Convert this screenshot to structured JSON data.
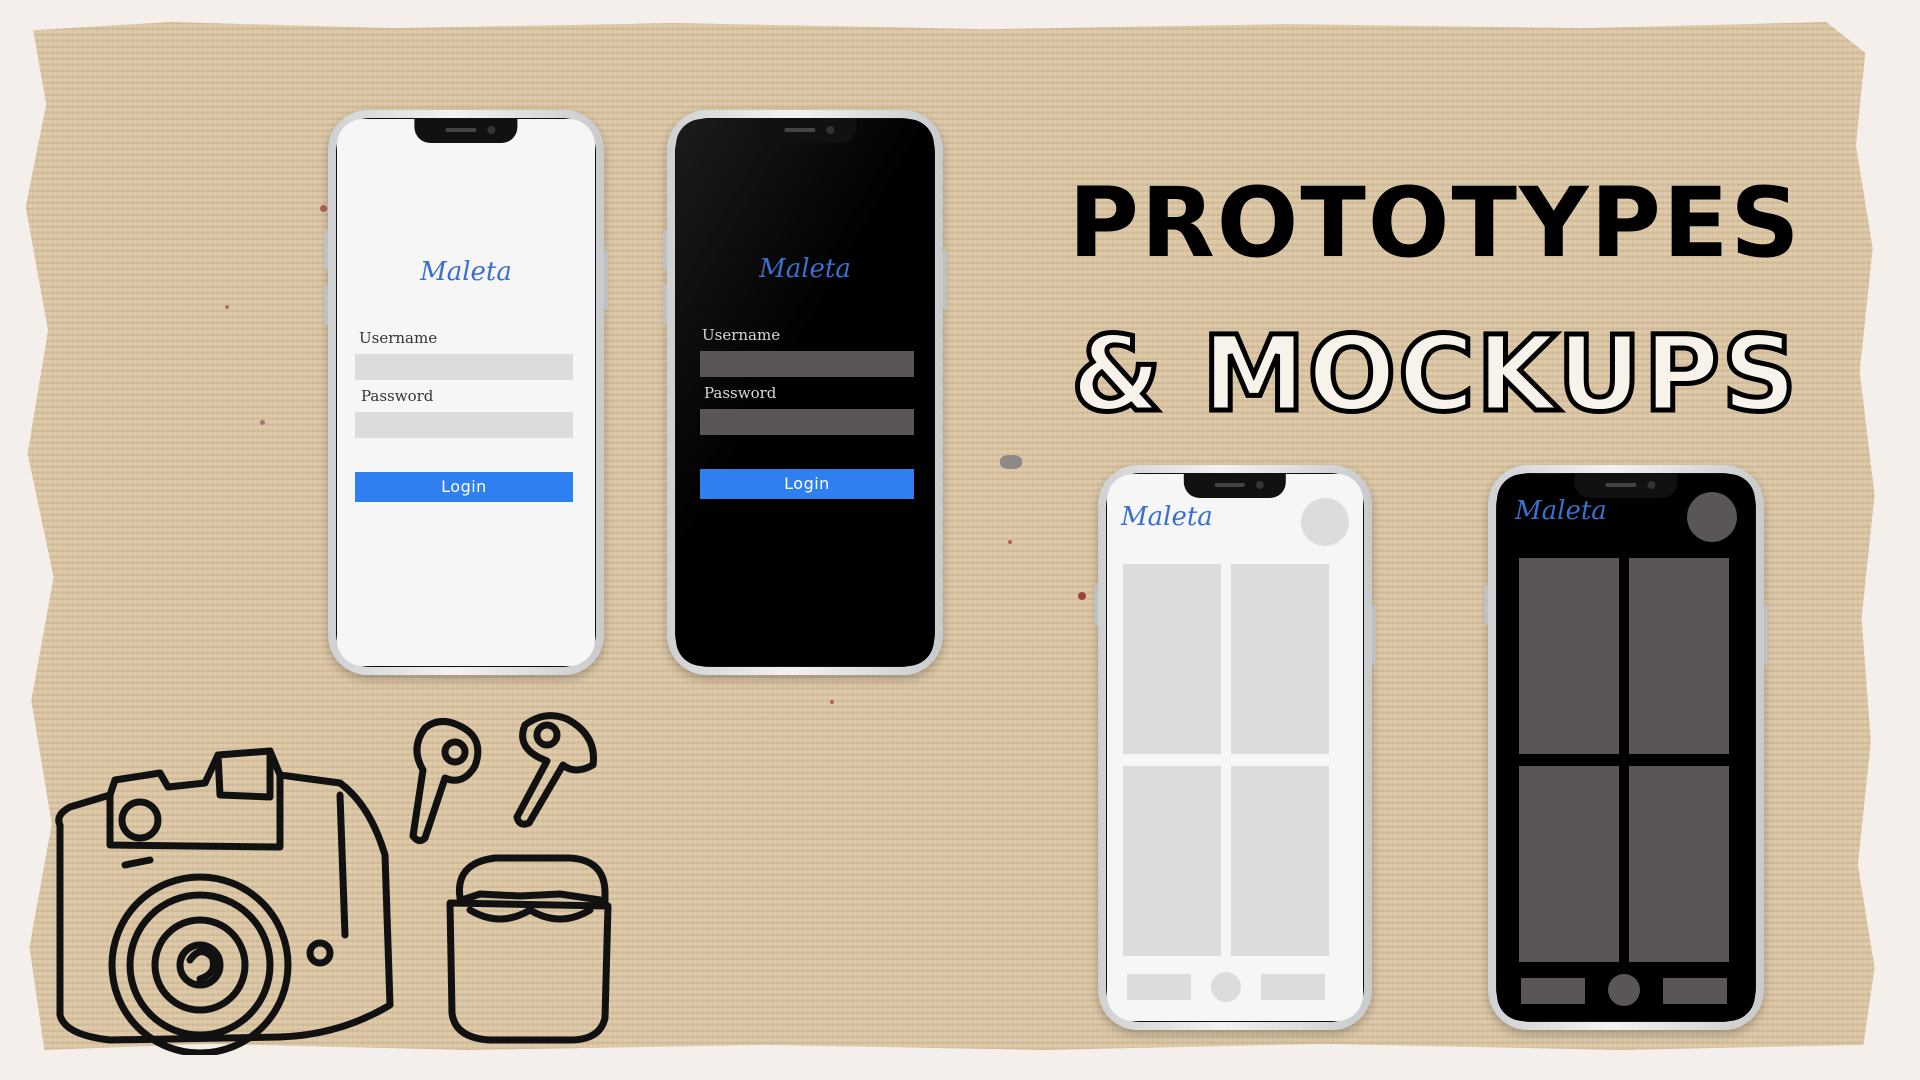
{
  "headline": {
    "line1": "PROTOTYPES",
    "line2": "& MOCKUPS"
  },
  "login_light": {
    "brand": "Maleta",
    "username_label": "Username",
    "password_label": "Password",
    "login_label": "Login"
  },
  "login_dark": {
    "brand": "Maleta",
    "username_label": "Username",
    "password_label": "Password",
    "login_label": "Login"
  },
  "feed_light": {
    "brand": "Maleta"
  },
  "feed_dark": {
    "brand": "Maleta"
  },
  "colors": {
    "accent_blue": "#2f7ff0",
    "brand_blue": "#3a6fd0",
    "paper": "#ddc8a6",
    "background": "#f4efea",
    "light_screen": "#f6f6f6",
    "dark_screen": "#000000",
    "light_placeholder": "#dcdcdc",
    "dark_placeholder": "#5a5657"
  },
  "icons": [
    "camera-icon",
    "earbud-icon",
    "earbud-case-icon"
  ]
}
